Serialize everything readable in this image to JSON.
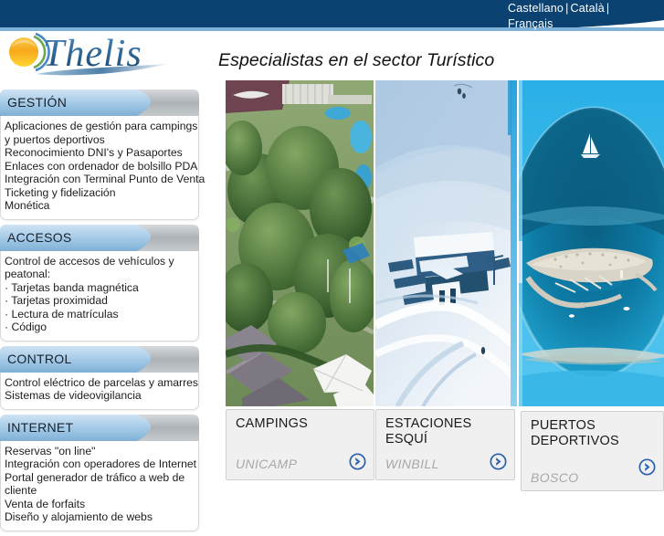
{
  "topbar": {
    "languages": [
      {
        "label": "Castellano"
      },
      {
        "label": "Català"
      },
      {
        "label": "Français"
      }
    ],
    "separator": "|",
    "bg_color": "#0b4271",
    "underline_color": "#7fb2d8"
  },
  "logo": {
    "wordmark": "Thelis",
    "icon_name": "sun-swoosh-logo",
    "text_color": "#2d6ca2",
    "sun_color": "#f5a623",
    "sun_color_light": "#ffd84d",
    "arc_green": "#6aa84f",
    "arc_blue": "#4a86c8"
  },
  "headline": {
    "text": "Especialistas en el sector Turístico"
  },
  "sidebar": {
    "sections": [
      {
        "title": "GESTIÓN",
        "items": [
          "Aplicaciones de gestión para campings y puertos deportivos",
          "Reconocimiento DNI's y Pasaportes",
          "Enlaces con ordenador de bolsillo PDA",
          "Integración con Terminal Punto de Venta",
          "Ticketing y fidelización",
          "Monética"
        ]
      },
      {
        "title": "ACCESOS",
        "items": [
          "Control de accesos de vehículos y peatonal:",
          "· Tarjetas banda magnética",
          "· Tarjetas proximidad",
          "· Lectura de matrículas",
          "· Código"
        ]
      },
      {
        "title": "CONTROL",
        "items": [
          "Control eléctrico de parcelas y amarres",
          "Sistemas de videovigilancia"
        ]
      },
      {
        "title": "INTERNET",
        "items": [
          "Reservas \"on line\"",
          "Integración con operadores de Internet",
          "Portal generador de tráfico a web de cliente",
          "Venta de forfaits",
          "Diseño y alojamiento de webs"
        ]
      }
    ]
  },
  "main": {
    "photos": [
      {
        "name": "campings-aerial-photo",
        "alt": "Vista aérea de camping con árboles y bungalows"
      },
      {
        "name": "ski-station-photo",
        "alt": "Estación de esquí nevada con edificio"
      },
      {
        "name": "marina-photo",
        "alt": "Vista de puerto deportivo e isla rodeada de mar"
      }
    ],
    "cards": [
      {
        "title": "CAMPINGS",
        "product": "UNICAMP",
        "arrow_name": "go-arrow-icon"
      },
      {
        "title": "ESTACIONES ESQUÍ",
        "product": "WINBILL",
        "arrow_name": "go-arrow-icon"
      },
      {
        "title": "PUERTOS DEPORTIVOS",
        "product": "BOSCO",
        "arrow_name": "go-arrow-icon"
      }
    ]
  },
  "colors": {
    "panel_head_light": "#b9d6ef",
    "panel_head_dark": "#8cb9dd",
    "panel_head_gray": "#b0b4b8",
    "card_bg": "#f0f0f0",
    "arrow_blue": "#2b62ad"
  }
}
